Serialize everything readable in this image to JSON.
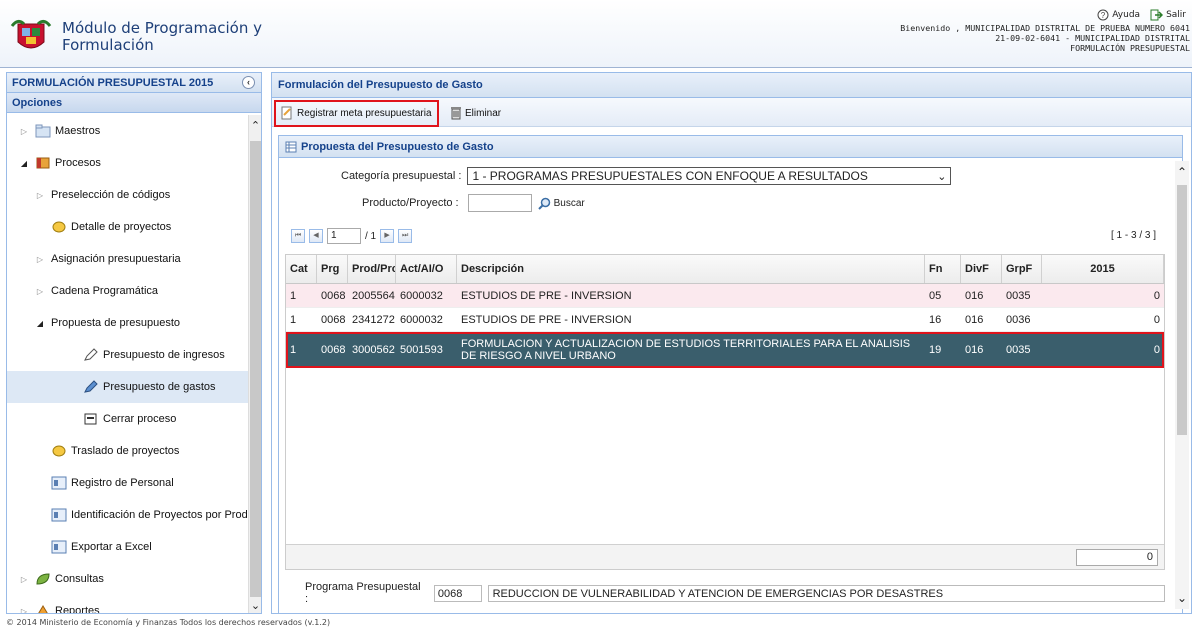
{
  "header": {
    "app_title_line1": "Módulo de Programación y",
    "app_title_line2": "Formulación",
    "help_label": "Ayuda",
    "exit_label": "Salir",
    "user_line1": "Bienvenido , MUNICIPALIDAD DISTRITAL DE PRUEBA NUMERO 6041",
    "user_line2": "21-09-02-6041 - MUNICIPALIDAD DISTRITAL",
    "user_line3": "FORMULACIÓN PRESUPUESTAL"
  },
  "left_panel": {
    "title": "FORMULACIÓN PRESUPUESTAL 2015",
    "subtitle": "Opciones",
    "items": [
      {
        "label": "Maestros",
        "icon": "folder-icon"
      },
      {
        "label": "Procesos",
        "icon": "book-icon"
      },
      {
        "label": "Preselección de códigos"
      },
      {
        "label": "Detalle de proyectos",
        "icon": "tag-icon"
      },
      {
        "label": "Asignación presupuestaria"
      },
      {
        "label": "Cadena Programática"
      },
      {
        "label": "Propuesta de presupuesto"
      },
      {
        "label": "Presupuesto de ingresos",
        "icon": "edit-icon"
      },
      {
        "label": "Presupuesto de gastos",
        "icon": "pencil-icon"
      },
      {
        "label": "Cerrar proceso",
        "icon": "close-process-icon"
      },
      {
        "label": "Traslado de proyectos",
        "icon": "tag-icon"
      },
      {
        "label": "Registro de Personal",
        "icon": "form-icon"
      },
      {
        "label": "Identificación de Proyectos por Prod",
        "icon": "form-icon"
      },
      {
        "label": "Exportar a Excel",
        "icon": "form-icon"
      },
      {
        "label": "Consultas",
        "icon": "leaf-icon"
      },
      {
        "label": "Reportes",
        "icon": "report-icon"
      }
    ]
  },
  "right_panel": {
    "title": "Formulación del Presupuesto de Gasto",
    "toolbar": {
      "register_label": "Registrar meta presupuestaria",
      "delete_label": "Eliminar"
    },
    "inner_title": "Propuesta del Presupuesto de Gasto",
    "categoria_label": "Categoría presupuestal :",
    "categoria_value": "1 - PROGRAMAS PRESUPUESTALES CON ENFOQUE A RESULTADOS",
    "producto_label": "Producto/Proyecto :",
    "producto_value": "",
    "buscar_label": "Buscar",
    "pager": {
      "page": "1",
      "of": "/ 1",
      "range": "[ 1 - 3 / 3 ]"
    },
    "grid": {
      "columns": [
        "Cat",
        "Prg",
        "Prod/Proy",
        "Act/AI/O",
        "Descripción",
        "Fn",
        "DivF",
        "GrpF",
        "2015"
      ],
      "rows": [
        {
          "cat": "1",
          "prg": "0068",
          "prod": "2005564",
          "act": "6000032",
          "desc": "ESTUDIOS DE PRE - INVERSION",
          "fn": "05",
          "divf": "016",
          "grpf": "0035",
          "y2015": "0"
        },
        {
          "cat": "1",
          "prg": "0068",
          "prod": "2341272",
          "act": "6000032",
          "desc": "ESTUDIOS DE PRE - INVERSION",
          "fn": "16",
          "divf": "016",
          "grpf": "0036",
          "y2015": "0"
        },
        {
          "cat": "1",
          "prg": "0068",
          "prod": "3000562",
          "act": "5001593",
          "desc": "FORMULACION Y ACTUALIZACION DE ESTUDIOS TERRITORIALES PARA EL ANALISIS DE RIESGO A NIVEL URBANO",
          "fn": "19",
          "divf": "016",
          "grpf": "0035",
          "y2015": "0"
        }
      ],
      "total": "0"
    },
    "programa_label": "Programa Presupuestal :",
    "programa_code": "0068",
    "programa_value": "REDUCCION DE VULNERABILIDAD Y ATENCION DE EMERGENCIAS POR DESASTRES"
  },
  "footer": {
    "copyright": "© 2014 Ministerio de Economía y Finanzas Todos los derechos reservados (v.1.2)"
  },
  "colors": {
    "highlight": "#e0131b",
    "selected_row": "#3a5e6c",
    "panel_title": "#15428b"
  }
}
